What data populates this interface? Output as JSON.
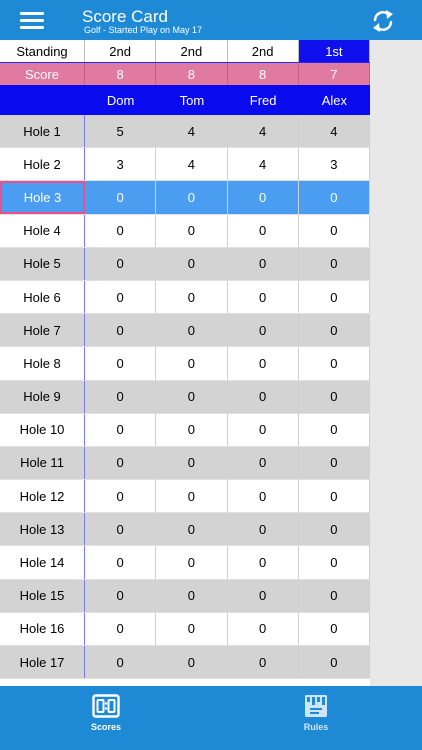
{
  "header": {
    "title": "Score Card",
    "subtitle": "Golf - Started Play on May 17"
  },
  "standing": {
    "label": "Standing",
    "values": [
      "2nd",
      "2nd",
      "2nd",
      "1st"
    ]
  },
  "score": {
    "label": "Score",
    "values": [
      "8",
      "8",
      "8",
      "7"
    ]
  },
  "players": [
    "Dom",
    "Tom",
    "Fred",
    "Alex"
  ],
  "holes": [
    {
      "label": "Hole 1",
      "scores": [
        "5",
        "4",
        "4",
        "4"
      ]
    },
    {
      "label": "Hole 2",
      "scores": [
        "3",
        "4",
        "4",
        "3"
      ]
    },
    {
      "label": "Hole 3",
      "scores": [
        "0",
        "0",
        "0",
        "0"
      ]
    },
    {
      "label": "Hole 4",
      "scores": [
        "0",
        "0",
        "0",
        "0"
      ]
    },
    {
      "label": "Hole 5",
      "scores": [
        "0",
        "0",
        "0",
        "0"
      ]
    },
    {
      "label": "Hole 6",
      "scores": [
        "0",
        "0",
        "0",
        "0"
      ]
    },
    {
      "label": "Hole 7",
      "scores": [
        "0",
        "0",
        "0",
        "0"
      ]
    },
    {
      "label": "Hole 8",
      "scores": [
        "0",
        "0",
        "0",
        "0"
      ]
    },
    {
      "label": "Hole 9",
      "scores": [
        "0",
        "0",
        "0",
        "0"
      ]
    },
    {
      "label": "Hole 10",
      "scores": [
        "0",
        "0",
        "0",
        "0"
      ]
    },
    {
      "label": "Hole 11",
      "scores": [
        "0",
        "0",
        "0",
        "0"
      ]
    },
    {
      "label": "Hole 12",
      "scores": [
        "0",
        "0",
        "0",
        "0"
      ]
    },
    {
      "label": "Hole 13",
      "scores": [
        "0",
        "0",
        "0",
        "0"
      ]
    },
    {
      "label": "Hole 14",
      "scores": [
        "0",
        "0",
        "0",
        "0"
      ]
    },
    {
      "label": "Hole 15",
      "scores": [
        "0",
        "0",
        "0",
        "0"
      ]
    },
    {
      "label": "Hole 16",
      "scores": [
        "0",
        "0",
        "0",
        "0"
      ]
    },
    {
      "label": "Hole 17",
      "scores": [
        "0",
        "0",
        "0",
        "0"
      ]
    }
  ],
  "selected_hole": "Hole 3",
  "tabs": {
    "scores": "Scores",
    "rules": "Rules"
  },
  "icons": {
    "menu": "hamburger-menu-icon",
    "refresh": "refresh-icon",
    "scores": "scoreboard-icon",
    "rules": "ruler-icon"
  },
  "colors": {
    "header_bg": "#1e8ad6",
    "leader_bg": "#1010ee",
    "score_bg": "#e07aa0",
    "names_bg": "#0a0aee",
    "selected_row": "#4a9df0",
    "selected_border": "#ee4f8a"
  }
}
